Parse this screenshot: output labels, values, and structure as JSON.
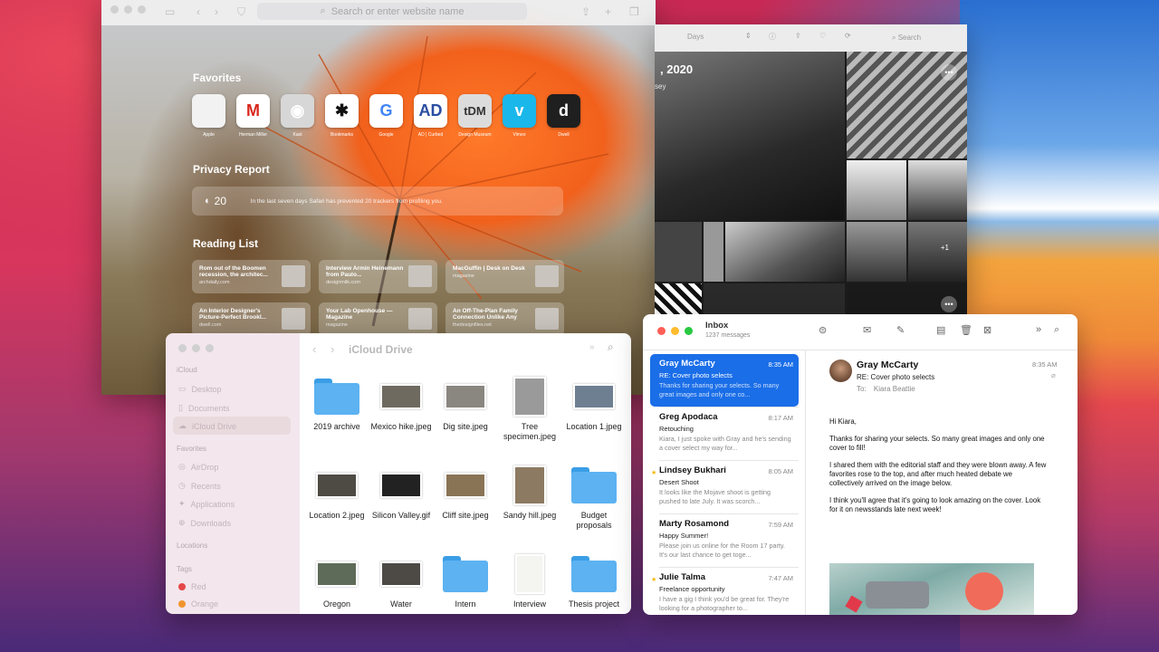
{
  "safari": {
    "search_placeholder": "Search or enter website name",
    "favorites_title": "Favorites",
    "favorites": [
      {
        "label": "Apple",
        "glyph": "",
        "bg": "#f2f2f2",
        "fg": "#555555"
      },
      {
        "label": "Herman Miller",
        "glyph": "M",
        "bg": "#ffffff",
        "fg": "#d9281e"
      },
      {
        "label": "Kaol",
        "glyph": "◉",
        "bg": "#d7d7d7",
        "fg": "#ffffff"
      },
      {
        "label": "Bookmarks",
        "glyph": "✱",
        "bg": "#ffffff",
        "fg": "#111111"
      },
      {
        "label": "Google",
        "glyph": "G",
        "bg": "#ffffff",
        "fg": "#4285f4"
      },
      {
        "label": "AD | Curbed",
        "glyph": "AD",
        "bg": "#ffffff",
        "fg": "#2b4ea2"
      },
      {
        "label": "Design Museum",
        "glyph": "tDM",
        "bg": "#dcdcdc",
        "fg": "#333333"
      },
      {
        "label": "Vimeo",
        "glyph": "v",
        "bg": "#1ab7ea",
        "fg": "#ffffff"
      },
      {
        "label": "Dwell",
        "glyph": "d",
        "bg": "#1f1f1f",
        "fg": "#ffffff"
      }
    ],
    "privacy_title": "Privacy Report",
    "privacy_count": "20",
    "privacy_text": "In the last seven days Safari has prevented 20 trackers from profiling you.",
    "reading_title": "Reading List",
    "reading_list": [
      {
        "title": "Rom out of the Boomen recession, the architec...",
        "sub": "archdaily.com"
      },
      {
        "title": "Interview Armin Heinemann from Paulo...",
        "sub": "designmilk.com"
      },
      {
        "title": "MacGuffin | Desk on Desk",
        "sub": "magazine"
      },
      {
        "title": "An Interior Designer's Picture-Perfect Brookl...",
        "sub": "dwell.com"
      },
      {
        "title": "Your Lab Openhouse — Magazine",
        "sub": "magazine"
      },
      {
        "title": "An Off-The-Plan Family Connection Unlike Any",
        "sub": "thedesignfiles.net"
      }
    ]
  },
  "photos": {
    "view_select": "Days",
    "search": "Search",
    "date": ", 2020",
    "location": "sey",
    "extra_count": "+1"
  },
  "finder": {
    "title": "iCloud Drive",
    "sidebar": {
      "icloud_head": "iCloud",
      "icloud": [
        "Desktop",
        "Documents",
        "iCloud Drive"
      ],
      "favorites_head": "Favorites",
      "favorites": [
        "AirDrop",
        "Recents",
        "Applications",
        "Downloads"
      ],
      "locations_head": "Locations",
      "tags_head": "Tags",
      "tags": [
        {
          "name": "Red",
          "color": "#e54848"
        },
        {
          "name": "Orange",
          "color": "#f0962e"
        }
      ]
    },
    "files": [
      {
        "name": "2019 archive",
        "kind": "folder"
      },
      {
        "name": "Mexico hike.jpeg",
        "kind": "image",
        "tone": "#6f6a60"
      },
      {
        "name": "Dig site.jpeg",
        "kind": "image",
        "tone": "#8a8680"
      },
      {
        "name": "Tree specimen.jpeg",
        "kind": "image",
        "tone": "#9a9a9a"
      },
      {
        "name": "Location 1.jpeg",
        "kind": "image",
        "tone": "#6e7f92"
      },
      {
        "name": "Location 2.jpeg",
        "kind": "image",
        "tone": "#4e4a44"
      },
      {
        "name": "Silicon Valley.gif",
        "kind": "image",
        "tone": "#222222"
      },
      {
        "name": "Cliff site.jpeg",
        "kind": "image",
        "tone": "#8a7456"
      },
      {
        "name": "Sandy hill.jpeg",
        "kind": "image",
        "tone": "#8c7a62"
      },
      {
        "name": "Budget proposals",
        "kind": "folder"
      },
      {
        "name": "Oregon",
        "kind": "image",
        "tone": "#5e6b58"
      },
      {
        "name": "Water",
        "kind": "image",
        "tone": "#4d4a46"
      },
      {
        "name": "Intern",
        "kind": "folder"
      },
      {
        "name": "Interview",
        "kind": "doc"
      },
      {
        "name": "Thesis project",
        "kind": "folder"
      }
    ]
  },
  "mail": {
    "mailbox": "Inbox",
    "count": "1237 messages",
    "messages": [
      {
        "from": "Gray McCarty",
        "time": "8:35 AM",
        "subject": "RE: Cover photo selects",
        "preview": "Thanks for sharing your selects. So many great images and only one co...",
        "selected": true,
        "star": false
      },
      {
        "from": "Greg Apodaca",
        "time": "8:17 AM",
        "subject": "Retouching",
        "preview": "Kiara, I just spoke with Gray and he's sending a cover select my way for...",
        "selected": false,
        "star": false
      },
      {
        "from": "Lindsey Bukhari",
        "time": "8:05 AM",
        "subject": "Desert Shoot",
        "preview": "It looks like the Mojave shoot is getting pushed to late July. It was scorch...",
        "selected": false,
        "star": true
      },
      {
        "from": "Marty Rosamond",
        "time": "7:59 AM",
        "subject": "Happy Summer!",
        "preview": "Please join us online for the Room 17 party. It's our last chance to get toge...",
        "selected": false,
        "star": false
      },
      {
        "from": "Julie Talma",
        "time": "7:47 AM",
        "subject": "Freelance opportunity",
        "preview": "I have a gig I think you'd be great for. They're looking for a photographer to...",
        "selected": false,
        "star": true
      }
    ],
    "reader": {
      "from": "Gray McCarty",
      "subject": "RE: Cover photo selects",
      "to_label": "To:",
      "to": "Kiara Beattie",
      "time": "8:35 AM",
      "body": [
        "Hi Kiara,",
        "Thanks for sharing your selects. So many great images and only one cover to fill!",
        "I shared them with the editorial staff and they were blown away. A few favorites rose to the top, and after much heated debate we collectively arrived on the image below.",
        "I think you'll agree that it's going to look amazing on the cover. Look for it on newsstands late next week!"
      ]
    }
  }
}
